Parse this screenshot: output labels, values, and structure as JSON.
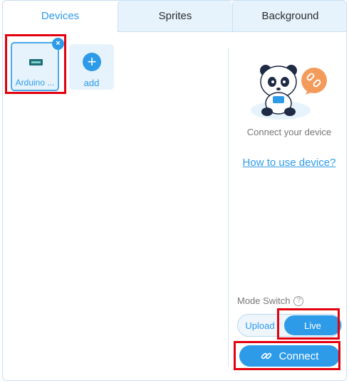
{
  "tabs": [
    {
      "label": "Devices",
      "active": true
    },
    {
      "label": "Sprites",
      "active": false
    },
    {
      "label": "Background",
      "active": false
    }
  ],
  "devices": {
    "current": {
      "label": "Arduino ...",
      "icon": "arduino-board-icon",
      "remove_symbol": "×"
    },
    "add": {
      "symbol": "+",
      "label": "add"
    }
  },
  "side": {
    "illustration": "panda-with-broken-link-icon",
    "connect_hint": "Connect your device",
    "help_link": "How to use device?",
    "mode_switch": {
      "label": "Mode Switch",
      "help_symbol": "?",
      "options": [
        "Upload",
        "Live"
      ],
      "selected": "Live"
    },
    "connect_button": "Connect"
  },
  "colors": {
    "accent": "#2e9be9",
    "tab_bg": "#e6f3fc",
    "highlight": "#e3000f",
    "link_badge": "#f39b5b"
  }
}
